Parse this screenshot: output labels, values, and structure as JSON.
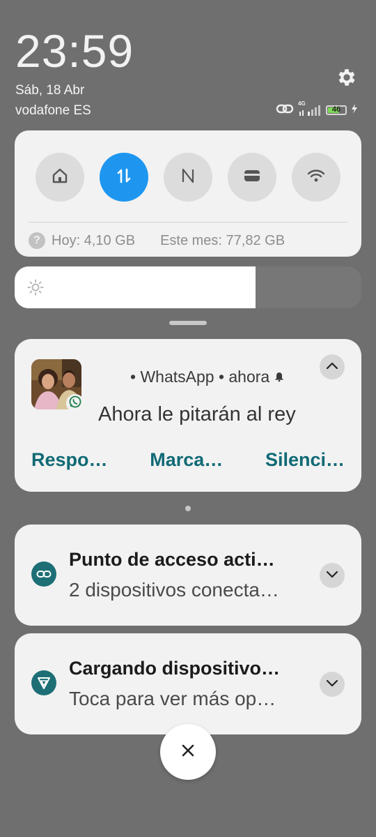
{
  "status": {
    "time": "23:59",
    "date": "Sáb, 18 Abr",
    "carrier": "vodafone ES",
    "network_type": "4G",
    "battery_level": "46",
    "icons": [
      "gear-icon",
      "hotspot-link-icon",
      "signal-icon",
      "battery-icon",
      "charging-bolt-icon"
    ]
  },
  "quick_settings": {
    "toggles": [
      {
        "name": "home-icon",
        "active": false
      },
      {
        "name": "mobile-data-icon",
        "active": true
      },
      {
        "name": "nfc-icon",
        "active": false
      },
      {
        "name": "wallet-icon",
        "active": false
      },
      {
        "name": "wifi-icon",
        "active": false
      }
    ],
    "data_today": "Hoy: 4,10 GB",
    "data_month": "Este mes: 77,82 GB",
    "accent_color": "#1e96f0"
  },
  "brightness": {
    "level": 0.695,
    "icon": "sun-icon"
  },
  "whatsapp": {
    "app_name": "• WhatsApp • ahora",
    "message": "Ahora le pitarán al rey",
    "actions": [
      "Respo…",
      "Marca…",
      "Silenci…"
    ],
    "action_color": "#0f6a75"
  },
  "hotspot": {
    "title": "Punto de acceso acti…",
    "subtitle": "2 dispositivos conecta…"
  },
  "charging": {
    "title": "Cargando dispositivo…",
    "subtitle": "Toca para ver más op…"
  }
}
